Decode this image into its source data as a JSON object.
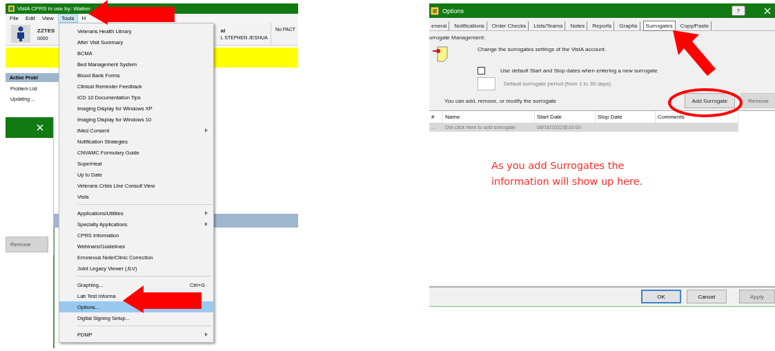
{
  "cprs_window": {
    "title": "VistA CPRS in use by: Walker",
    "menu": [
      {
        "label": "File",
        "selected": false
      },
      {
        "label": "Edit",
        "selected": false
      },
      {
        "label": "View",
        "selected": false
      },
      {
        "label": "Tools",
        "selected": true
      },
      {
        "label": "H",
        "selected": false
      }
    ],
    "patient": {
      "name": "ZZTES",
      "id": "0000",
      "provider_label": "al",
      "provider": "L STEPHEN JESHUA",
      "pact": "No PACT"
    },
    "problems_panel": {
      "title": "Active Probl",
      "lines": [
        "Problem List",
        "Updating ..."
      ]
    },
    "side_window": {
      "button": "Remove"
    },
    "tools_menu": [
      {
        "kind": "item",
        "label": "Veterans Health Library",
        "selected": false
      },
      {
        "kind": "item",
        "label": "After Visit Summary",
        "selected": false
      },
      {
        "kind": "item",
        "label": "BCMA",
        "selected": false
      },
      {
        "kind": "item",
        "label": "Bed Management System",
        "selected": false
      },
      {
        "kind": "item",
        "label": "Blood Bank Forms",
        "selected": false
      },
      {
        "kind": "item",
        "label": "Clinical Reminder Feedback",
        "selected": false
      },
      {
        "kind": "item",
        "label": "ICD 10 Documentation Tips",
        "selected": false
      },
      {
        "kind": "item",
        "label": "Imaging Display for Windows XP",
        "selected": false
      },
      {
        "kind": "item",
        "label": "Imaging Display for Windows 10",
        "selected": false
      },
      {
        "kind": "item",
        "label": "iMed Consent",
        "selected": false,
        "submenu": true
      },
      {
        "kind": "item",
        "label": "Notification Strategies",
        "selected": false
      },
      {
        "kind": "item",
        "label": "CNVAMC Formulary Guide",
        "selected": false
      },
      {
        "kind": "item",
        "label": "SuperHeal",
        "selected": false
      },
      {
        "kind": "item",
        "label": "Up to Date",
        "selected": false
      },
      {
        "kind": "item",
        "label": "Veterans Crisis Line Consult View",
        "selected": false
      },
      {
        "kind": "item",
        "label": "Vista",
        "selected": false
      },
      {
        "kind": "separator"
      },
      {
        "kind": "item",
        "label": "Applications/Utilities",
        "selected": false,
        "submenu": true
      },
      {
        "kind": "item",
        "label": "Specialty Applications",
        "selected": false,
        "submenu": true
      },
      {
        "kind": "item",
        "label": "CPRS Information",
        "selected": false
      },
      {
        "kind": "item",
        "label": "Webinars/Guidelines",
        "selected": false
      },
      {
        "kind": "item",
        "label": "Erroneous Note/Clinic Correction",
        "selected": false
      },
      {
        "kind": "item",
        "label": "Joint Legacy Viewer (JLV)",
        "selected": false
      },
      {
        "kind": "separator"
      },
      {
        "kind": "item",
        "label": "Graphing...",
        "selected": false,
        "shortcut": "Ctrl+G"
      },
      {
        "kind": "item",
        "label": "Lab Test Informa",
        "selected": false
      },
      {
        "kind": "item",
        "label": "Options...",
        "selected": true
      },
      {
        "kind": "item",
        "label": "Digital Signing Setup...",
        "selected": false
      },
      {
        "kind": "separator"
      },
      {
        "kind": "item",
        "label": "PDMP",
        "selected": false,
        "submenu": true
      }
    ]
  },
  "options_dialog": {
    "title": "Options",
    "help": "?",
    "tabs": [
      {
        "label": "eneral",
        "selected": false
      },
      {
        "label": "Notifications",
        "selected": false
      },
      {
        "label": "Order Checks",
        "selected": false
      },
      {
        "label": "Lists/Teams",
        "selected": false
      },
      {
        "label": "Notes",
        "selected": false
      },
      {
        "label": "Reports",
        "selected": false
      },
      {
        "label": "Graphs",
        "selected": false
      },
      {
        "label": "Surrogates",
        "selected": true
      },
      {
        "label": "Copy/Paste",
        "selected": false
      }
    ],
    "section": "urrogate Management:",
    "description": "Change the surrogates settings of the VistA account.",
    "checkbox": {
      "label": "Use default Start and Stop dates when entering a new surrogate",
      "checked": false
    },
    "period_field": {
      "label": "Default surrogate period (from 1 to 30 days)",
      "disabled": true
    },
    "instruction": "You can add, remove, or modify the surrogate",
    "actions": [
      {
        "label": "Add Surrogate",
        "disabled": false
      },
      {
        "label": "Remove",
        "disabled": true
      }
    ],
    "columns": [
      "#",
      "Name",
      "Start Date",
      "Stop Date",
      "Comments"
    ],
    "rows": [
      {
        "marker": "...",
        "name": "Dbl-click here to add surrogate",
        "start_date": "08/16/2022@10:00"
      }
    ],
    "note": "As you add Surrogates the information will show up here.",
    "buttons": [
      {
        "label": "OK",
        "default": true,
        "disabled": false
      },
      {
        "label": "Cancel",
        "default": false,
        "disabled": false
      },
      {
        "label": "Apply",
        "default": false,
        "disabled": true
      }
    ]
  }
}
